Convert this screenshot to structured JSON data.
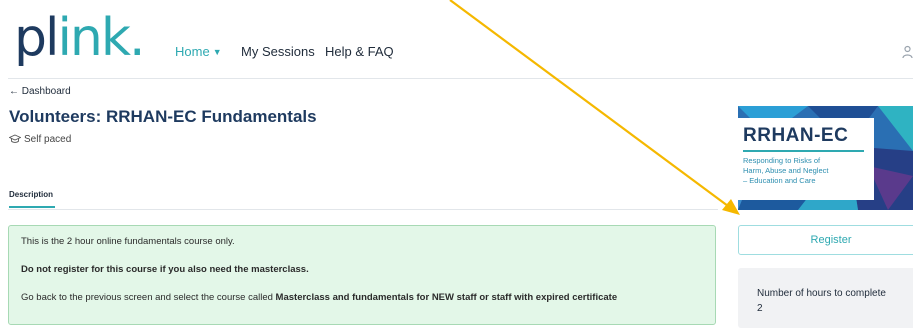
{
  "header": {
    "logo_part1": "pl",
    "logo_part2": "ink.",
    "nav": {
      "home": "Home",
      "sessions": "My Sessions",
      "help": "Help & FAQ"
    }
  },
  "breadcrumb": {
    "back_label": "← Dashboard"
  },
  "course": {
    "title": "Volunteers: RRHAN-EC Fundamentals",
    "pace": "Self paced"
  },
  "tabs": [
    {
      "label": "Description"
    }
  ],
  "description": {
    "line1": "This is the 2 hour online fundamentals course only.",
    "line2": "Do not register for this course if you also need the masterclass.",
    "line3_prefix": "Go back to the previous screen and select the course called ",
    "line3_course": "Masterclass and fundamentals for NEW staff or staff with expired certificate"
  },
  "banner": {
    "title": "RRHAN-EC",
    "subtitle_lines": [
      "Responding to Risks of",
      "Harm, Abuse and Neglect",
      "– Education and Care"
    ]
  },
  "register_label": "Register",
  "info": {
    "label": "Number of hours to complete",
    "value": "2"
  },
  "colors": {
    "brand_navy": "#1e3a5f",
    "brand_teal": "#2ea9b1",
    "notice_bg": "#e3f7e8",
    "annotation_arrow": "#f5b800"
  }
}
